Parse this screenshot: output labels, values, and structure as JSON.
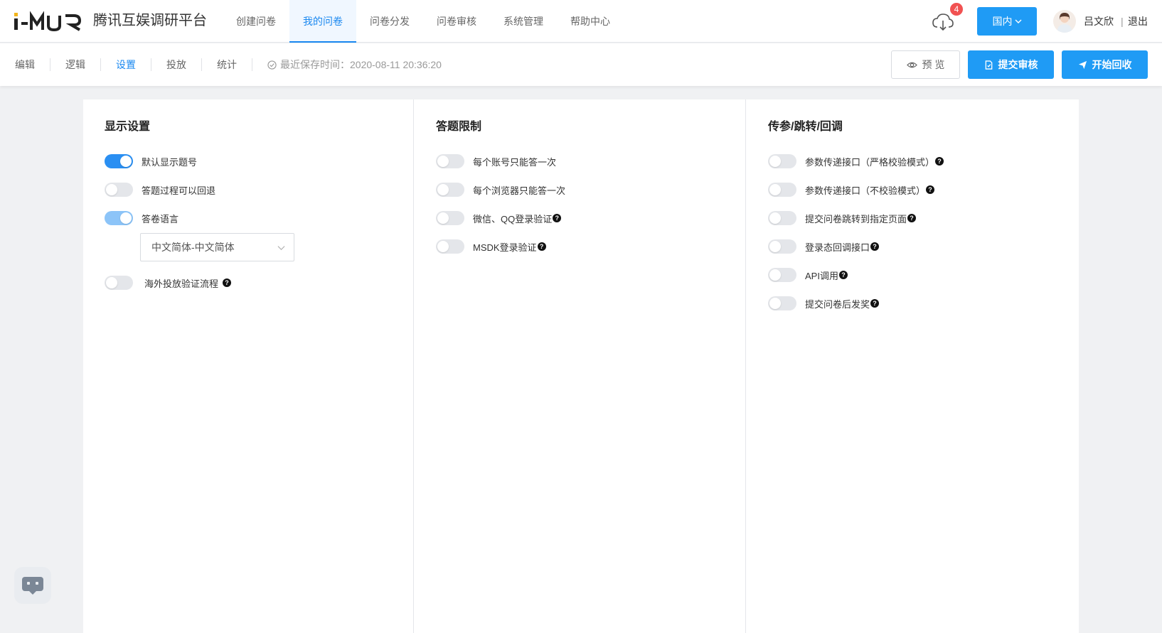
{
  "header": {
    "logo_text": "i-MUR",
    "platform_title": "腾讯互娱调研平台",
    "nav": [
      {
        "label": "创建问卷",
        "active": false
      },
      {
        "label": "我的问卷",
        "active": true
      },
      {
        "label": "问卷分发",
        "active": false
      },
      {
        "label": "问卷审核",
        "active": false
      },
      {
        "label": "系统管理",
        "active": false
      },
      {
        "label": "帮助中心",
        "active": false
      }
    ],
    "download_badge": "4",
    "region_label": "国内",
    "username": "吕文欣",
    "logout_separator": "|",
    "logout_label": "退出"
  },
  "subbar": {
    "tabs": [
      {
        "label": "编辑",
        "active": false
      },
      {
        "label": "逻辑",
        "active": false
      },
      {
        "label": "设置",
        "active": true
      },
      {
        "label": "投放",
        "active": false
      },
      {
        "label": "统计",
        "active": false
      }
    ],
    "save_info": "最近保存时间：2020-08-11 20:36:20",
    "preview_label": "预 览",
    "submit_label": "提交审核",
    "start_label": "开始回收"
  },
  "panels": {
    "display": {
      "title": "显示设置",
      "options": [
        {
          "label": "默认显示题号",
          "on": true,
          "help": false
        },
        {
          "label": "答题过程可以回退",
          "on": false,
          "help": false
        },
        {
          "label": "答卷语言",
          "on": true,
          "help": false
        },
        {
          "label": "海外投放验证流程",
          "on": false,
          "help": true
        }
      ],
      "language_select": "中文简体-中文简体"
    },
    "limits": {
      "title": "答题限制",
      "options": [
        {
          "label": "每个账号只能答一次",
          "on": false,
          "help": false
        },
        {
          "label": "每个浏览器只能答一次",
          "on": false,
          "help": false
        },
        {
          "label": "微信、QQ登录验证",
          "on": false,
          "help": true
        },
        {
          "label": "MSDK登录验证",
          "on": false,
          "help": true
        }
      ]
    },
    "params": {
      "title": "传参/跳转/回调",
      "options": [
        {
          "label": "参数传递接口（严格校验模式）",
          "on": false,
          "help": true
        },
        {
          "label": "参数传递接口（不校验模式）",
          "on": false,
          "help": true
        },
        {
          "label": "提交问卷跳转到指定页面",
          "on": false,
          "help": true
        },
        {
          "label": "登录态回调接口",
          "on": false,
          "help": true
        },
        {
          "label": "API调用",
          "on": false,
          "help": true
        },
        {
          "label": "提交问卷后发奖",
          "on": false,
          "help": true
        }
      ]
    }
  },
  "help_glyph": "?",
  "colors": {
    "primary": "#1f9bf5",
    "active_text": "#1a88f0",
    "toggle_on": "#2a8ff2",
    "toggle_off": "#e4e6ea",
    "badge": "#f15151"
  }
}
